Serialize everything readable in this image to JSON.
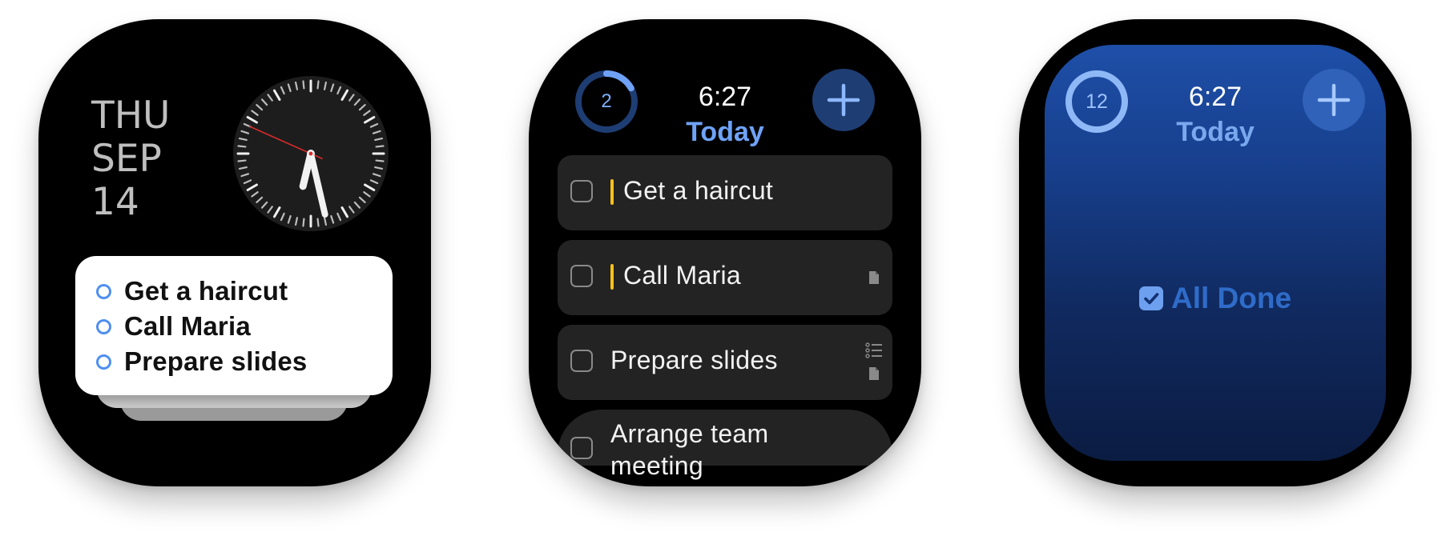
{
  "widget_face": {
    "date": {
      "weekday": "THU",
      "month": "SEP",
      "day": "14"
    },
    "clock": {
      "hours": 6,
      "minutes": 27,
      "seconds": 49
    },
    "widget_tasks": [
      {
        "label": "Get a haircut"
      },
      {
        "label": "Call Maria"
      },
      {
        "label": "Prepare slides"
      }
    ]
  },
  "list_screen": {
    "time": "6:27",
    "title": "Today",
    "remaining_count": "2",
    "progress_fraction": 0.17,
    "tasks": [
      {
        "label": "Get a haircut",
        "priority": true,
        "icons": []
      },
      {
        "label": "Call Maria",
        "priority": true,
        "icons": [
          "note-icon"
        ]
      },
      {
        "label": "Prepare slides",
        "priority": false,
        "icons": [
          "checklist-icon",
          "note-icon"
        ]
      },
      {
        "label": "Arrange team meeting",
        "priority": false,
        "icons": []
      }
    ]
  },
  "done_screen": {
    "time": "6:27",
    "title": "Today",
    "completed_count": "12",
    "progress_fraction": 1.0,
    "message": "All Done"
  },
  "colors": {
    "accent_blue": "#6fa2f7",
    "priority_yellow": "#f5c21b",
    "ring_track": "#1e3d73",
    "ring_fill": "#6fa2f7"
  }
}
